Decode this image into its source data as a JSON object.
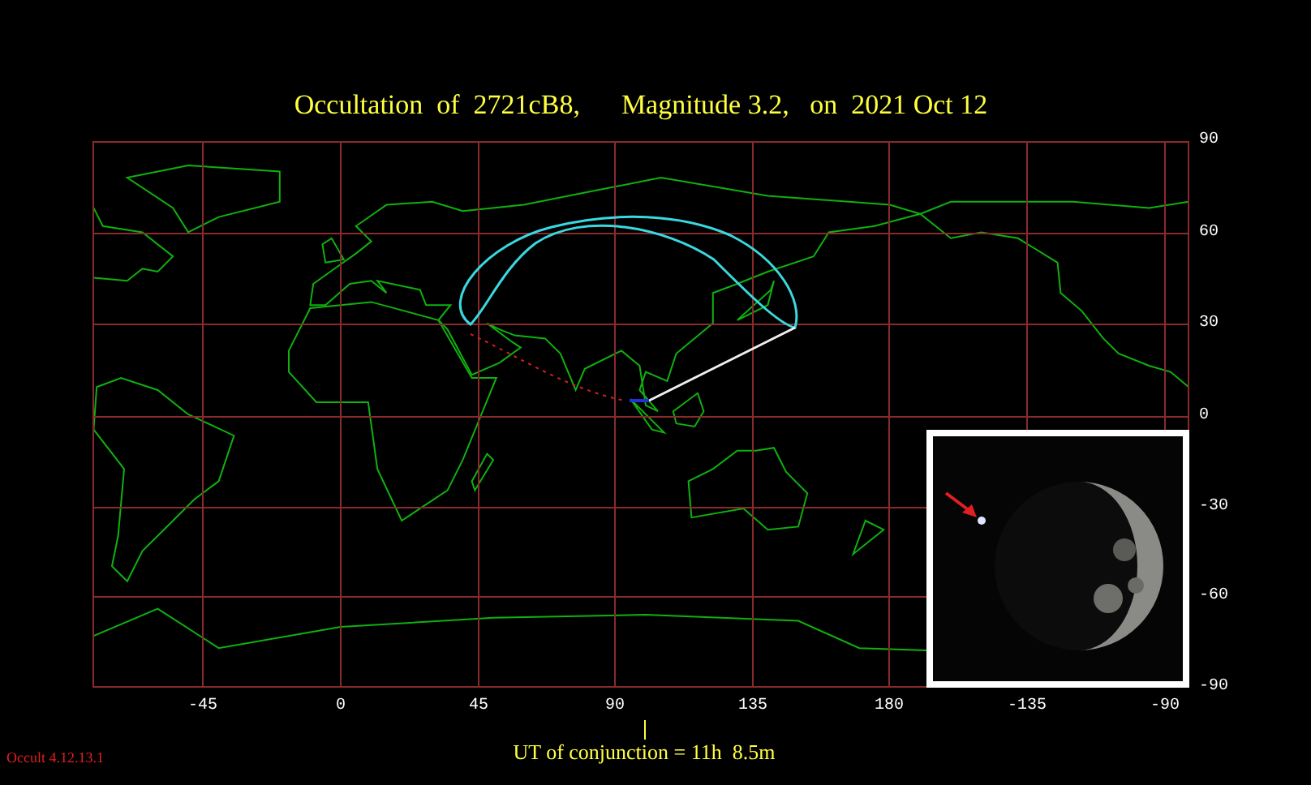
{
  "title": "Occultation  of  2721cB8,      Magnitude 3.2,   on  2021 Oct 12",
  "latitude_labels": [
    "90",
    "60",
    "30",
    "0",
    "-30",
    "-60",
    "-90"
  ],
  "longitude_labels": [
    "-45",
    "0",
    "45",
    "90",
    "135",
    "180",
    "-135",
    "-90"
  ],
  "inset": {
    "kind": "picture"
  },
  "conjunction": "UT of conjunction = 11h  8.5m",
  "version": "Occult 4.12.13.1"
}
